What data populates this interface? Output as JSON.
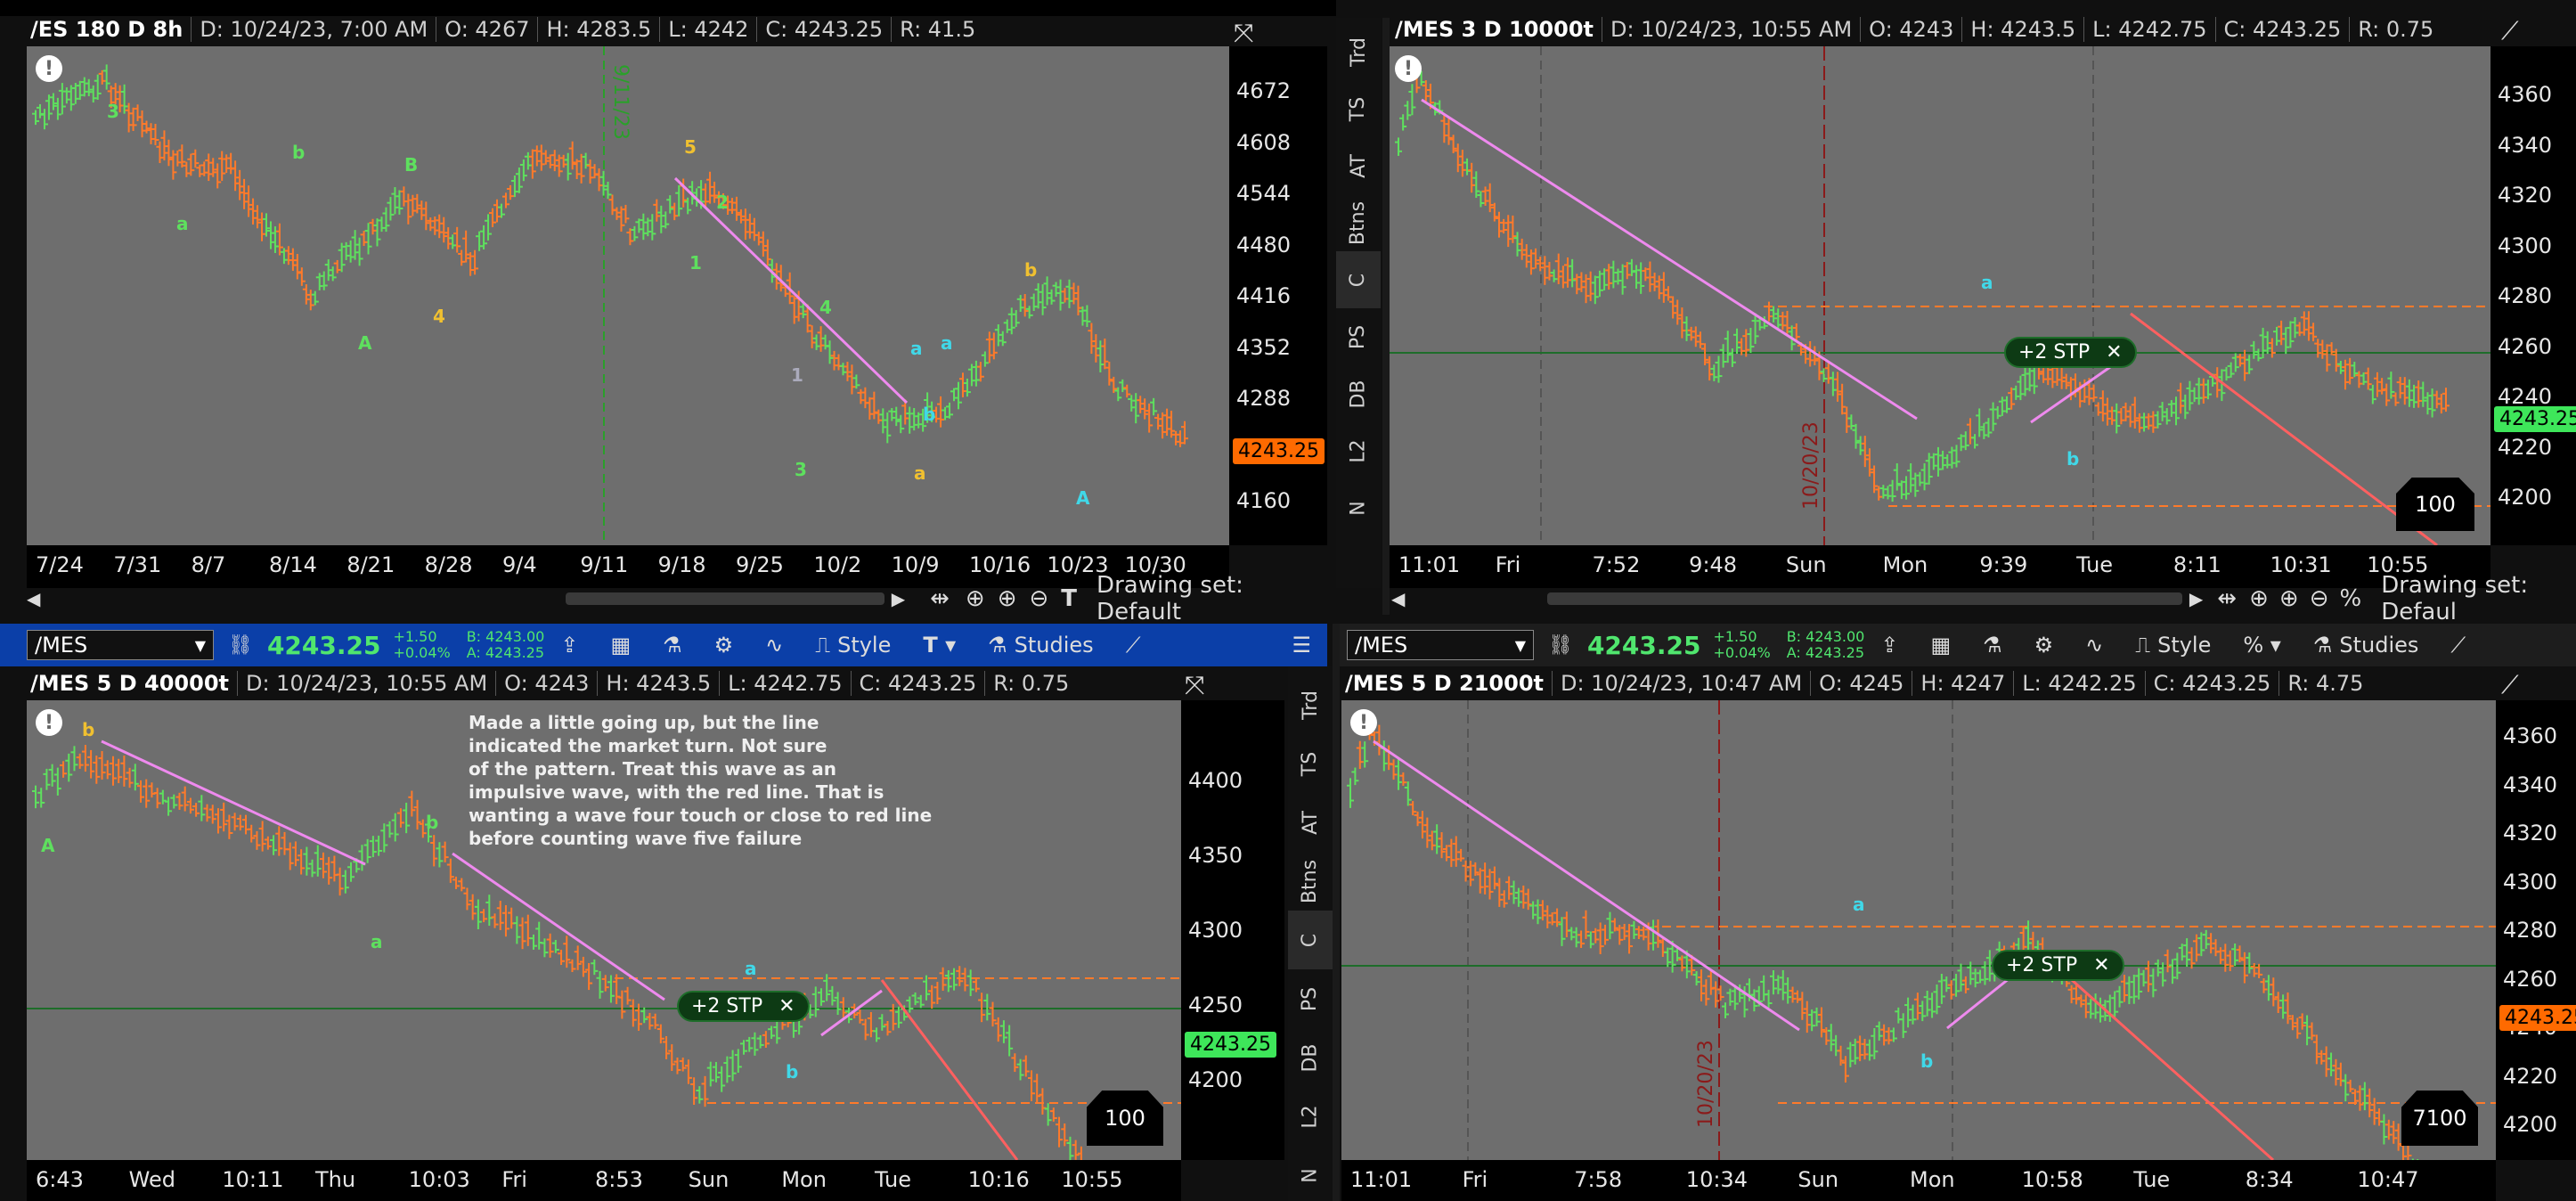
{
  "panels": {
    "tl": {
      "title": "/ES 180 D 8h",
      "date": "D: 10/24/23, 7:00 AM",
      "o": "O: 4267",
      "h": "H: 4283.5",
      "l": "L: 4242",
      "c": "C: 4243.25",
      "r": "R: 41.5",
      "yticks": [
        "4672",
        "4608",
        "4544",
        "4480",
        "4416",
        "4352",
        "4288",
        "4224",
        "4160"
      ],
      "xticks": [
        "7/24",
        "7/31",
        "8/7",
        "8/14",
        "8/21",
        "8/28",
        "9/4",
        "9/11",
        "9/18",
        "9/25",
        "10/2",
        "10/9",
        "10/16",
        "10/23",
        "10/30"
      ],
      "price_tag": "4243.25",
      "vline_label": "9/11/23",
      "waves": [
        "3",
        "b",
        "a",
        "B",
        "A",
        "4",
        "5",
        "2",
        "1",
        "4",
        "1",
        "3",
        "a",
        "a",
        "b",
        "b",
        "a",
        "A"
      ],
      "drawing_set": "Drawing set: Default"
    },
    "tr": {
      "title": "/MES 3 D 10000t",
      "date": "D: 10/24/23, 10:55 AM",
      "o": "O: 4243",
      "h": "H: 4243.5",
      "l": "L: 4242.75",
      "c": "C: 4243.25",
      "r": "R: 0.75",
      "yticks": [
        "4360",
        "4340",
        "4320",
        "4300",
        "4280",
        "4260",
        "4240",
        "4220",
        "4200"
      ],
      "xticks": [
        "11:01",
        "Fri",
        "7:52",
        "9:48",
        "Sun",
        "Mon",
        "9:39",
        "Tue",
        "8:11",
        "10:31",
        "10:55"
      ],
      "price_tag": "4243.25",
      "vline_label": "10/20/23",
      "waves": [
        "a",
        "b"
      ],
      "stp": "+2 STP",
      "box": "100",
      "drawing_set": "Drawing set: Defaul"
    },
    "bl": {
      "symbol": "/MES",
      "last": "4243.25",
      "chg1": "+1.50",
      "chg2": "+0.04%",
      "bid": "B: 4243.00",
      "ask": "A: 4243.25",
      "style": "Style",
      "studies": "Studies",
      "title": "/MES 5 D 40000t",
      "date": "D: 10/24/23, 10:55 AM",
      "o": "O: 4243",
      "h": "H: 4243.5",
      "l": "L: 4242.75",
      "c": "C: 4243.25",
      "r": "R: 0.75",
      "yticks": [
        "4400",
        "4350",
        "4300",
        "4250",
        "4200"
      ],
      "xticks": [
        "6:43",
        "Wed",
        "10:11",
        "Thu",
        "10:03",
        "Fri",
        "8:53",
        "Sun",
        "Mon",
        "Tue",
        "10:16",
        "10:55"
      ],
      "price_tag": "4243.25",
      "waves": [
        "b",
        "A",
        "a",
        "b",
        "a",
        "b"
      ],
      "note": [
        "Made a little going up, but the line",
        "indicated the market turn. Not sure",
        "of the pattern. Treat this wave as an",
        "impulsive wave, with the red line. That is",
        "wanting a wave four touch or close to red line",
        "before counting wave five failure"
      ],
      "stp": "+2 STP",
      "box": "100"
    },
    "br": {
      "symbol": "/MES",
      "last": "4243.25",
      "chg1": "+1.50",
      "chg2": "+0.04%",
      "bid": "B: 4243.00",
      "ask": "A: 4243.25",
      "style": "Style",
      "studies": "Studies",
      "title": "/MES 5 D 21000t",
      "date": "D: 10/24/23, 10:47 AM",
      "o": "O: 4245",
      "h": "H: 4247",
      "l": "L: 4242.25",
      "c": "C: 4243.25",
      "r": "R: 4.75",
      "yticks": [
        "4360",
        "4340",
        "4320",
        "4300",
        "4280",
        "4260",
        "4240",
        "4220",
        "4200"
      ],
      "xticks": [
        "11:01",
        "Fri",
        "7:58",
        "10:34",
        "Sun",
        "Mon",
        "10:58",
        "Tue",
        "8:34",
        "10:47"
      ],
      "price_tag": "4243.25",
      "vline_label": "10/20/23",
      "waves": [
        "a",
        "b"
      ],
      "stp": "+2 STP",
      "box": "7100"
    }
  },
  "side_tabs": [
    "Trd",
    "TS",
    "AT",
    "Btns",
    "C",
    "PS",
    "DB",
    "L2",
    "N"
  ],
  "colors": {
    "up": "#5ee05e",
    "down": "#ff7a2a",
    "accent_price": "#ff6a00",
    "green_price": "#3ee65a",
    "pink": "#ee8aee",
    "red_line": "#ff6060",
    "dash_orange": "#ff7a2a",
    "bg_chart": "#6e6e6e",
    "toolbar_blue": "#0b3fa8"
  }
}
